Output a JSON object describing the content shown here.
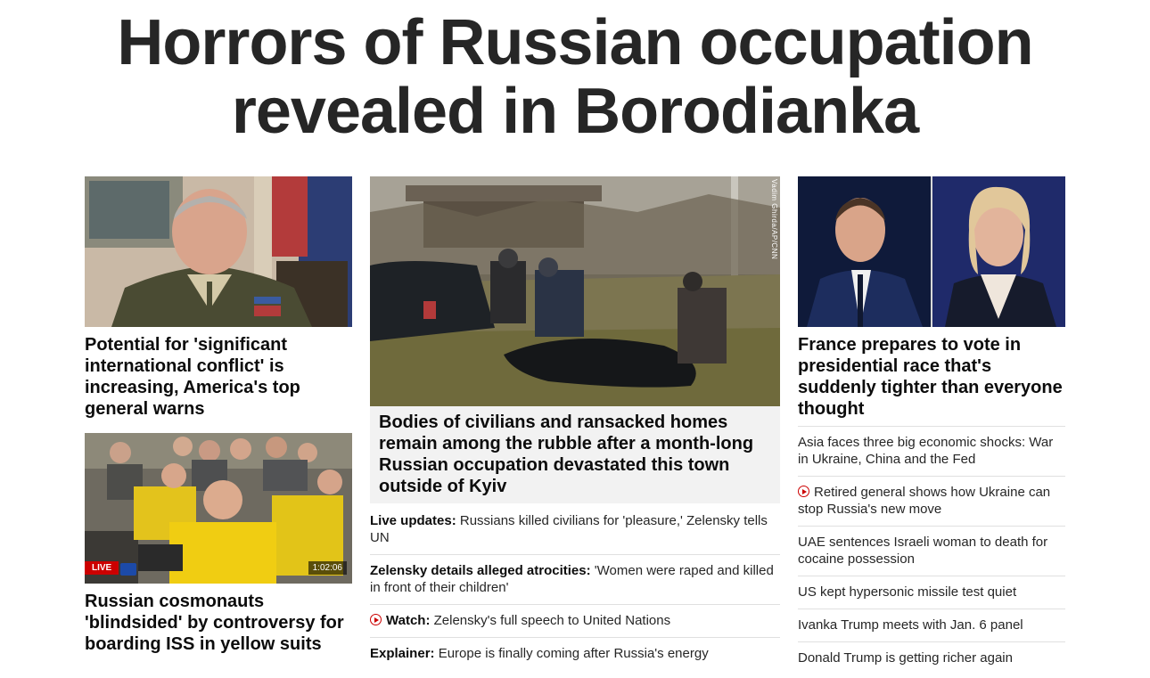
{
  "headline": "Horrors of Russian occupation revealed in Borodianka",
  "left": {
    "story1_title": "Potential for 'significant international conflict' is increasing, America's top general warns",
    "story2_title": "Russian cosmonauts 'blindsided' by controversy for boarding ISS in yellow suits",
    "story2_live_badge": "LIVE",
    "story2_duration": "1:02:06"
  },
  "center": {
    "image_credit": "Vadim Ghirda/AP/CNN",
    "feature_title": "Bodies of civilians and ransacked homes remain among the rubble after a month-long Russian occupation devastated this town outside of Kyiv",
    "items": [
      {
        "kicker": "Live updates:",
        "text": " Russians killed civilians for 'pleasure,' Zelensky tells UN",
        "video": false
      },
      {
        "kicker": "Zelensky details alleged atrocities:",
        "text": " 'Women were raped and killed in front of their children'",
        "video": false
      },
      {
        "kicker": "Watch:",
        "text": " Zelensky's full speech to United Nations",
        "video": true
      },
      {
        "kicker": "Explainer:",
        "text": " Europe is finally coming after Russia's energy",
        "video": false
      }
    ]
  },
  "right": {
    "story_title": "France prepares to vote in presidential race that's suddenly tighter than everyone thought",
    "items": [
      {
        "text": "Asia faces three big economic shocks: War in Ukraine, China and the Fed",
        "video": false
      },
      {
        "text": "Retired general shows how Ukraine can stop Russia's new move",
        "video": true
      },
      {
        "text": "UAE sentences Israeli woman to death for cocaine possession",
        "video": false
      },
      {
        "text": "US kept hypersonic missile test quiet",
        "video": false
      },
      {
        "text": "Ivanka Trump meets with Jan. 6 panel",
        "video": false
      },
      {
        "text": "Donald Trump is getting richer again",
        "video": false
      }
    ]
  },
  "colors": {
    "headline": "#262626",
    "video_accent": "#cc0000",
    "feature_box": "#f2f2f2"
  }
}
